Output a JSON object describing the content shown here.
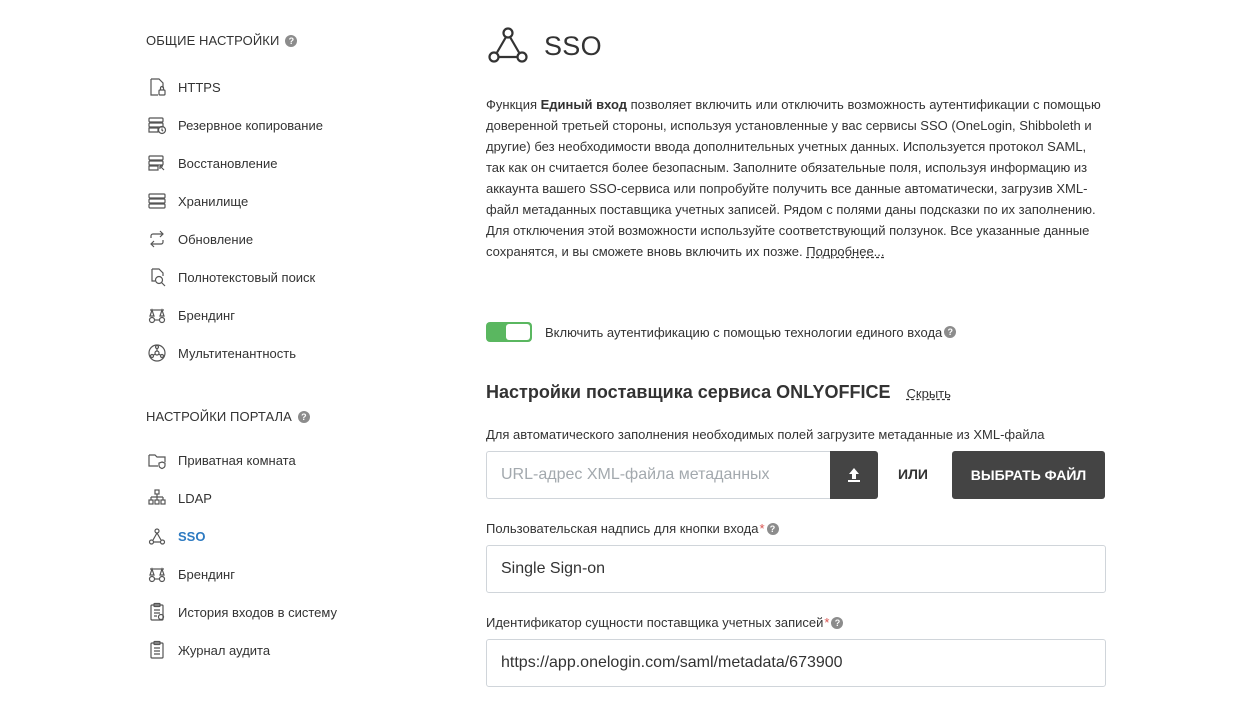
{
  "sidebar": {
    "general_title": "ОБЩИЕ НАСТРОЙКИ",
    "general_items": [
      {
        "label": "HTTPS",
        "icon": "lock-doc-icon"
      },
      {
        "label": "Резервное копирование",
        "icon": "backup-icon"
      },
      {
        "label": "Восстановление",
        "icon": "restore-icon"
      },
      {
        "label": "Хранилище",
        "icon": "storage-icon"
      },
      {
        "label": "Обновление",
        "icon": "update-icon"
      },
      {
        "label": "Полнотекстовый поиск",
        "icon": "search-doc-icon"
      },
      {
        "label": "Брендинг",
        "icon": "branding-icon"
      },
      {
        "label": "Мультитенантность",
        "icon": "multitenancy-icon"
      }
    ],
    "portal_title": "НАСТРОЙКИ ПОРТАЛА",
    "portal_items": [
      {
        "label": "Приватная комната",
        "icon": "private-room-icon"
      },
      {
        "label": "LDAP",
        "icon": "ldap-icon"
      },
      {
        "label": "SSO",
        "icon": "sso-icon",
        "active": true
      },
      {
        "label": "Брендинг",
        "icon": "branding-icon"
      },
      {
        "label": "История входов в систему",
        "icon": "login-history-icon"
      },
      {
        "label": "Журнал аудита",
        "icon": "audit-log-icon"
      }
    ]
  },
  "main": {
    "title": "SSO",
    "description": {
      "intro": "Функция ",
      "bold": "Единый вход",
      "body": " позволяет включить или отключить возможность аутентификации с помощью доверенной третьей стороны, используя установленные у вас сервисы SSO (OneLogin, Shibboleth и другие) без необходимости ввода дополнительных учетных данных. Используется протокол SAML, так как он считается более безопасным. Заполните обязательные поля, используя информацию из аккаунта вашего SSO-сервиса или попробуйте получить все данные автоматически, загрузив XML-файл метаданных поставщика учетных записей. Рядом с полями даны подсказки по их заполнению. Для отключения этой возможности используйте соответствующий ползунок. Все указанные данные сохранятся, и вы сможете вновь включить их позже. ",
      "more_link": "Подробнее..."
    },
    "toggle": {
      "label": "Включить аутентификацию с помощью технологии единого входа",
      "enabled": true
    },
    "section_title": "Настройки поставщика сервиса ONLYOFFICE",
    "hide_link": "Скрыть",
    "metadata_hint": "Для автоматического заполнения необходимых полей загрузите метаданные из XML-файла",
    "metadata_url_placeholder": "URL-адрес XML-файла метаданных",
    "metadata_url_value": "",
    "or_label": "ИЛИ",
    "choose_file_label": "ВЫБРАТЬ ФАЙЛ",
    "button_caption_label": "Пользовательская надпись для кнопки входа",
    "button_caption_value": "Single Sign-on",
    "entity_id_label": "Идентификатор сущности поставщика учетных записей",
    "entity_id_value": "https://app.onelogin.com/saml/metadata/673900",
    "required_mark": "*",
    "help_glyph": "?"
  },
  "colors": {
    "accent": "#2d7ac1",
    "toggle_on": "#5ab760",
    "dark_button": "#444444",
    "required": "#d9534f"
  }
}
